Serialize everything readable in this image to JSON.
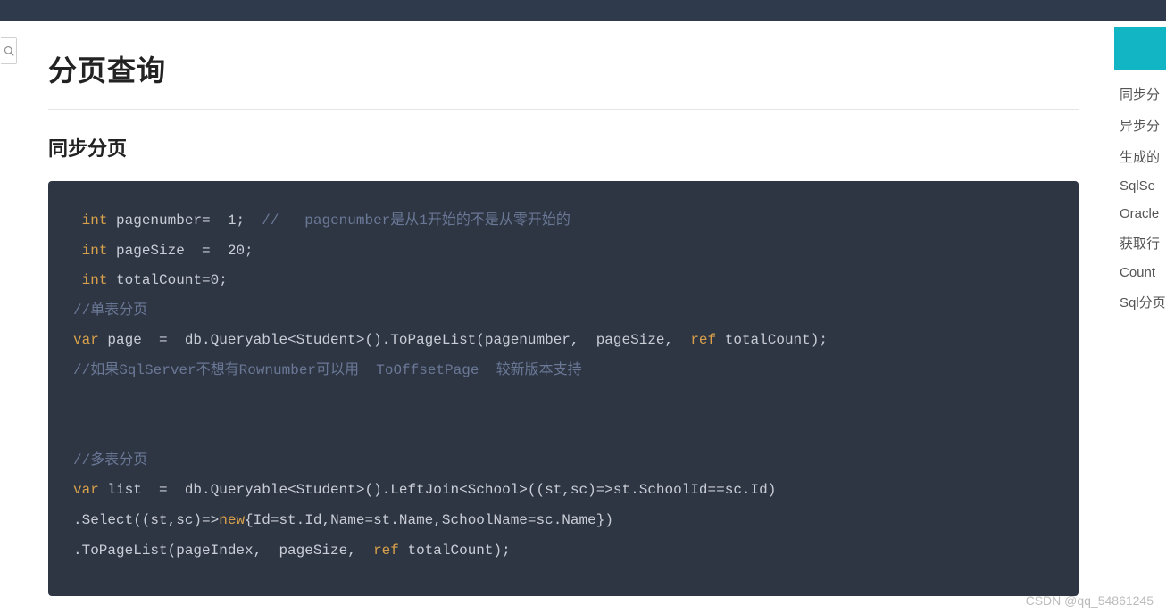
{
  "page": {
    "title": "分页查询",
    "section1_title": "同步分页"
  },
  "code": {
    "l1_kw": "int",
    "l1_rest": " pagenumber=  1;  ",
    "l1_cmt": "//   pagenumber是从1开始的不是从零开始的",
    "l2_kw": "int",
    "l2_rest": " pageSize  =  20;",
    "l3_kw": "int",
    "l3_rest": " totalCount=0;",
    "l4_cmt": "//单表分页",
    "l5_kw": "var",
    "l5_mid": " page  =  db.Queryable<Student>().ToPageList(pagenumber,  pageSize,  ",
    "l5_kw2": "ref",
    "l5_end": " totalCount);",
    "l6_cmt": "//如果SqlServer不想有Rownumber可以用  ToOffsetPage  较新版本支持",
    "blank": " ",
    "l8_cmt": "//多表分页",
    "l9_kw": "var",
    "l9_rest": " list  =  db.Queryable<Student>().LeftJoin<School>((st,sc)=>st.SchoolId==sc.Id)",
    "l10_a": ".Select((st,sc)=>",
    "l10_kw": "new",
    "l10_b": "{Id=st.Id,Name=st.Name,SchoolName=sc.Name})",
    "l11_a": ".ToPageList(pageIndex,  pageSize,  ",
    "l11_kw": "ref",
    "l11_b": " totalCount);"
  },
  "toc": {
    "items": [
      "同步分",
      "异步分",
      "生成的",
      "SqlSe",
      "Oracle",
      "获取行",
      "Count",
      "Sql分页"
    ]
  },
  "watermark": "CSDN @qq_54861245"
}
